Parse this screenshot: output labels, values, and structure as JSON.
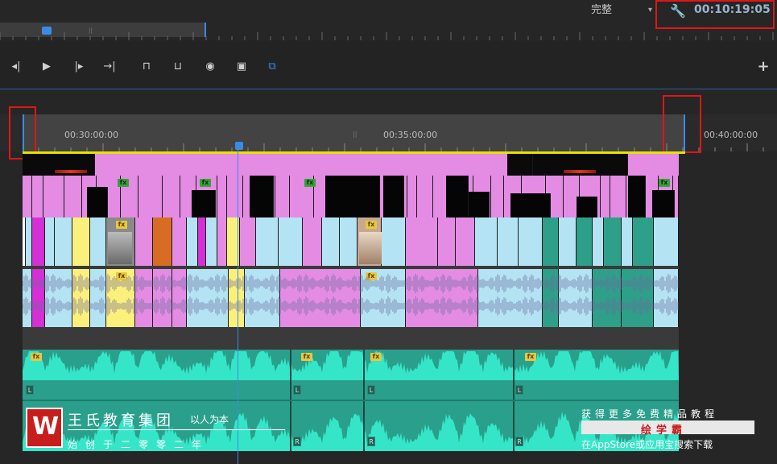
{
  "monitor": {
    "quality": "完整",
    "timecode": "00:10:19:05"
  },
  "transport": {
    "buttons": [
      "step-back",
      "play",
      "step-forward",
      "insert",
      "lift",
      "extract",
      "export-frame",
      "compare",
      "toggle-output"
    ]
  },
  "timeline": {
    "ticks": [
      "00:30:00:00",
      "00:35:00:00",
      "00:40:00:00"
    ],
    "channels": [
      "L",
      "R"
    ]
  },
  "watermark": {
    "logo": "W",
    "company": "王氏教育集团",
    "slogan": "以人为本",
    "tagline": "始创于二零零二年",
    "right_line1": "获得更多免费精品教程",
    "brand": "绘学霸",
    "right_line2": "在AppStore或应用宝搜索下载"
  },
  "colors": {
    "pink": "#e48ce4",
    "lightblue": "#b4e4f4",
    "magenta": "#d430d4",
    "yellow": "#fcf07c",
    "orange": "#d86c24",
    "teal": "#2ea08a",
    "audio": "#35e5c8",
    "accent_red": "#e01616"
  }
}
